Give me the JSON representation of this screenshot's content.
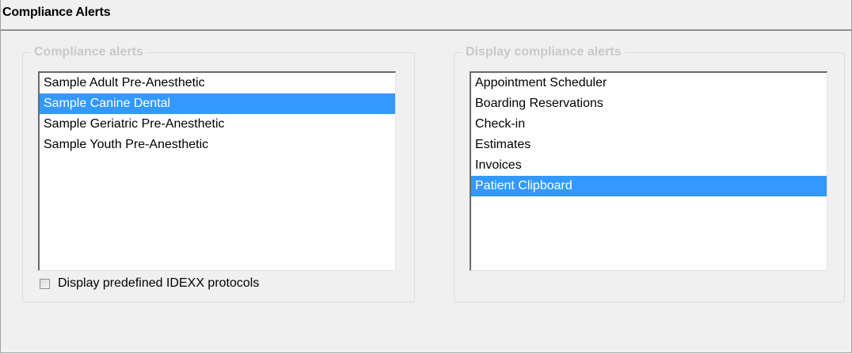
{
  "header": {
    "title": "Compliance Alerts"
  },
  "left_group": {
    "legend": "Compliance alerts",
    "items": [
      {
        "label": "Sample Adult Pre-Anesthetic",
        "selected": false
      },
      {
        "label": "Sample Canine Dental",
        "selected": true
      },
      {
        "label": "Sample Geriatric Pre-Anesthetic",
        "selected": false
      },
      {
        "label": "Sample Youth Pre-Anesthetic",
        "selected": false
      }
    ],
    "checkbox_label": "Display predefined IDEXX protocols",
    "checkbox_checked": false
  },
  "right_group": {
    "legend": "Display compliance alerts",
    "items": [
      {
        "label": "Appointment Scheduler",
        "selected": false
      },
      {
        "label": "Boarding Reservations",
        "selected": false
      },
      {
        "label": "Check-in",
        "selected": false
      },
      {
        "label": "Estimates",
        "selected": false
      },
      {
        "label": "Invoices",
        "selected": false
      },
      {
        "label": "Patient Clipboard",
        "selected": true
      }
    ]
  },
  "colors": {
    "selection": "#3399ff",
    "legend_text": "#c8c8c8",
    "background": "#f0f0f0"
  }
}
